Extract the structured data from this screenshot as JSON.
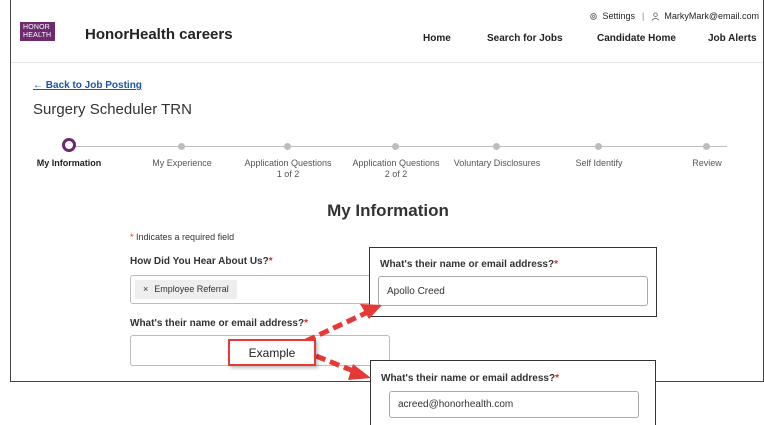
{
  "header": {
    "logo_line1": "HONOR",
    "logo_line2": "HEALTH",
    "brand": "HonorHealth careers",
    "settings": "Settings",
    "user_email": "MarkyMark@email.com",
    "nav": [
      "Home",
      "Search for Jobs",
      "Candidate Home",
      "Job Alerts"
    ]
  },
  "back_link": "Back to Job Posting",
  "job_title": "Surgery Scheduler TRN",
  "steps": [
    {
      "label": "My Information",
      "active": true
    },
    {
      "label": "My Experience"
    },
    {
      "label": "Application Questions 1 of 2"
    },
    {
      "label": "Application Questions 2 of 2"
    },
    {
      "label": "Voluntary Disclosures"
    },
    {
      "label": "Self Identify"
    },
    {
      "label": "Review"
    }
  ],
  "form": {
    "section_title": "My Information",
    "required_note": "Indicates a required field",
    "required_star": "*",
    "q1_label": "How Did You Hear About Us?",
    "q1_value": "Employee Referral",
    "q2_label": "What's their name or email address?"
  },
  "callout_top": {
    "label": "What's their name or email address?",
    "value": "Apollo Creed"
  },
  "callout_bottom": {
    "label": "What's their name or email address?",
    "value": "acreed@honorhealth.com"
  },
  "example_label": "Example",
  "colors": {
    "brand_purple": "#6d2a6f",
    "link_blue": "#1a56a8",
    "required_red": "#d32f2f",
    "arrow_red": "#e53935"
  }
}
